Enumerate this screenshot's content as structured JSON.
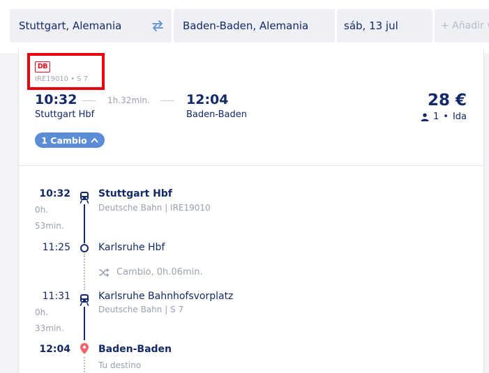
{
  "search": {
    "origin": "Stuttgart, Alemania",
    "destination": "Baden-Baden, Alemania",
    "date": "sáb, 13 jul",
    "add_return": "+ Añadir v"
  },
  "result": {
    "operator_logo": "DB",
    "train_id": "IRE19010 • S 7",
    "departure_time": "10:32",
    "duration": "1h.32min.",
    "arrival_time": "12:04",
    "departure_station": "Stuttgart Hbf",
    "arrival_station": "Baden-Baden",
    "price": "28 €",
    "passengers": "1",
    "trip_type": "Ida",
    "changes_label": "1 Cambio"
  },
  "itinerary": {
    "stop1": {
      "time": "10:32",
      "station": "Stuttgart Hbf",
      "detail": "Deutsche Bahn | IRE19010"
    },
    "leg1_duration": [
      "0h.",
      "53min."
    ],
    "stop2": {
      "time": "11:25",
      "station": "Karlsruhe Hbf"
    },
    "transfer": "Cambio, 0h.06min.",
    "stop3": {
      "time": "11:31",
      "station": "Karlsruhe Bahnhofsvorplatz",
      "detail": "Deutsche Bahn | S 7"
    },
    "leg2_duration": [
      "0h.",
      "33min."
    ],
    "stop4": {
      "time": "12:04",
      "station": "Baden-Baden",
      "detail": "Tu destino"
    }
  },
  "colors": {
    "navy": "#132968",
    "db_red": "#ea0a1b",
    "highlight_red": "#e8000f",
    "pill_blue": "#5b8dd6",
    "destination_pin": "#f0646c"
  },
  "icons": [
    "swap-arrows-icon",
    "person-icon",
    "chevron-up-icon",
    "train-icon",
    "stop-circle-icon",
    "shuffle-icon",
    "location-pin-icon"
  ]
}
